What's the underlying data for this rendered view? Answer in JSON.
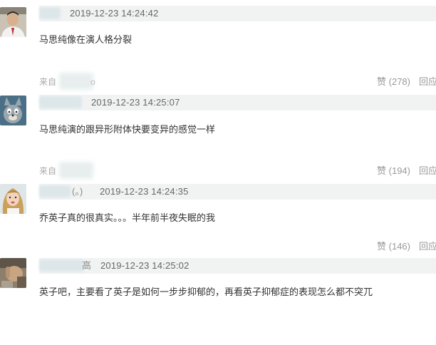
{
  "comments": [
    {
      "time": "2019-12-23 14:24:42",
      "text": "马思纯像在演人格分裂",
      "source_prefix": "来自",
      "source_suffix": "o",
      "likes": "赞 (278)",
      "reply": "回应"
    },
    {
      "time": "2019-12-23 14:25:07",
      "text": "马思纯演的跟异形附体快要变异的感觉一样",
      "source_prefix": "来自",
      "source_suffix": "",
      "likes": "赞 (194)",
      "reply": "回应"
    },
    {
      "user_suffix": "(。)",
      "time": "2019-12-23 14:24:35",
      "text": "乔英子真的很真实。。。半年前半夜失眠的我",
      "likes": "赞 (146)",
      "reply": "回应"
    },
    {
      "user_suffix": "高",
      "time": "2019-12-23 14:25:02",
      "text": "英子吧，主要看了英子是如何一步步抑郁的，再看英子抑郁症的表现怎么都不突兀"
    }
  ],
  "colors": {
    "header_bg": "#f1f3f3",
    "meta_text": "#999999",
    "body_text": "#333333"
  },
  "icons": [
    "avatar-man-photo",
    "avatar-tom-cat",
    "avatar-girl-photo",
    "avatar-hand-photo"
  ]
}
